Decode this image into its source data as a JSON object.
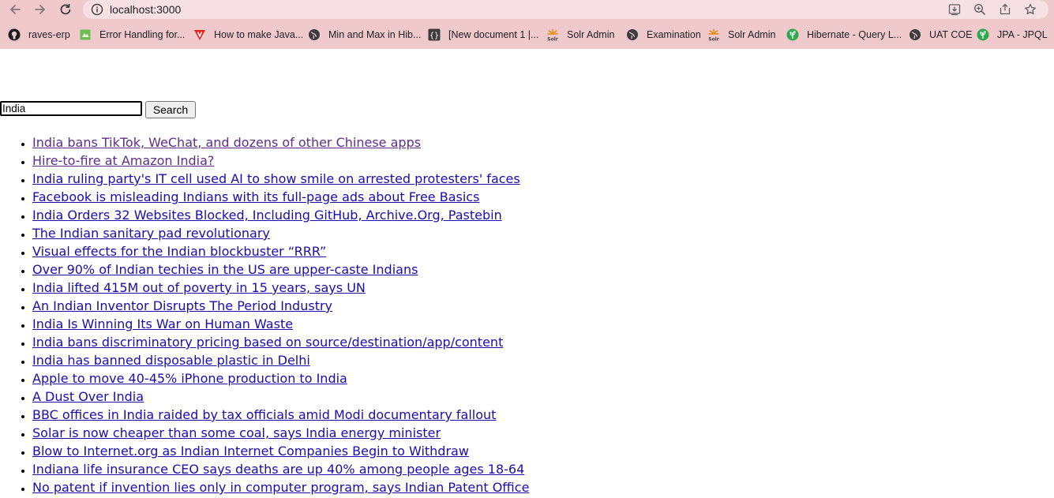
{
  "browser": {
    "url": "localhost:3000"
  },
  "bookmarks": [
    {
      "label": "raves-erp",
      "icon": "github-icon"
    },
    {
      "label": "Error Handling for...",
      "icon": "page-icon"
    },
    {
      "label": "How to make Java...",
      "icon": "red-v-icon"
    },
    {
      "label": "Min and Max in Hib...",
      "icon": "globe-icon"
    },
    {
      "label": "[New document 1 |...",
      "icon": "braces-icon"
    },
    {
      "label": "Solr Admin",
      "icon": "solr-icon"
    },
    {
      "label": "Examination",
      "icon": "globe-icon"
    },
    {
      "label": "Solr Admin",
      "icon": "solr-icon"
    },
    {
      "label": "Hibernate - Query L...",
      "icon": "green-leaf-icon"
    },
    {
      "label": "UAT COE",
      "icon": "globe-icon"
    },
    {
      "label": "JPA - JPQL",
      "icon": "green-leaf-icon"
    }
  ],
  "search": {
    "value": "India",
    "button_label": "Search"
  },
  "results": [
    "India bans TikTok, WeChat, and dozens of other Chinese apps",
    "Hire-to-fire at Amazon India?",
    "India ruling party's IT cell used AI to show smile on arrested protesters' faces",
    "Facebook is misleading Indians with its full-page ads about Free Basics",
    "India Orders 32 Websites Blocked, Including GitHub, Archive.Org, Pastebin",
    "The Indian sanitary pad revolutionary",
    "Visual effects for the Indian blockbuster “RRR”",
    "Over 90% of Indian techies in the US are upper-caste Indians",
    "India lifted 415M out of poverty in 15 years, says UN",
    "An Indian Inventor Disrupts The Period Industry",
    "India Is Winning Its War on Human Waste",
    "India bans discriminatory pricing based on source/destination/app/content",
    "India has banned disposable plastic in Delhi",
    "Apple to move 40-45% iPhone production to India",
    "A Dust Over India",
    "BBC offices in India raided by tax officials amid Modi documentary fallout",
    "Solar is now cheaper than some coal, says India energy minister",
    "Blow to Internet.org as Indian Internet Companies Begin to Withdraw",
    "Indiana life insurance CEO says deaths are up 40% among people ages 18-64",
    "No patent if invention lies only in computer program, says Indian Patent Office"
  ],
  "colors": {
    "chrome_bg": "#f0c9cd",
    "link": "#1a0dab",
    "visited_link": "#5e2d8a"
  }
}
